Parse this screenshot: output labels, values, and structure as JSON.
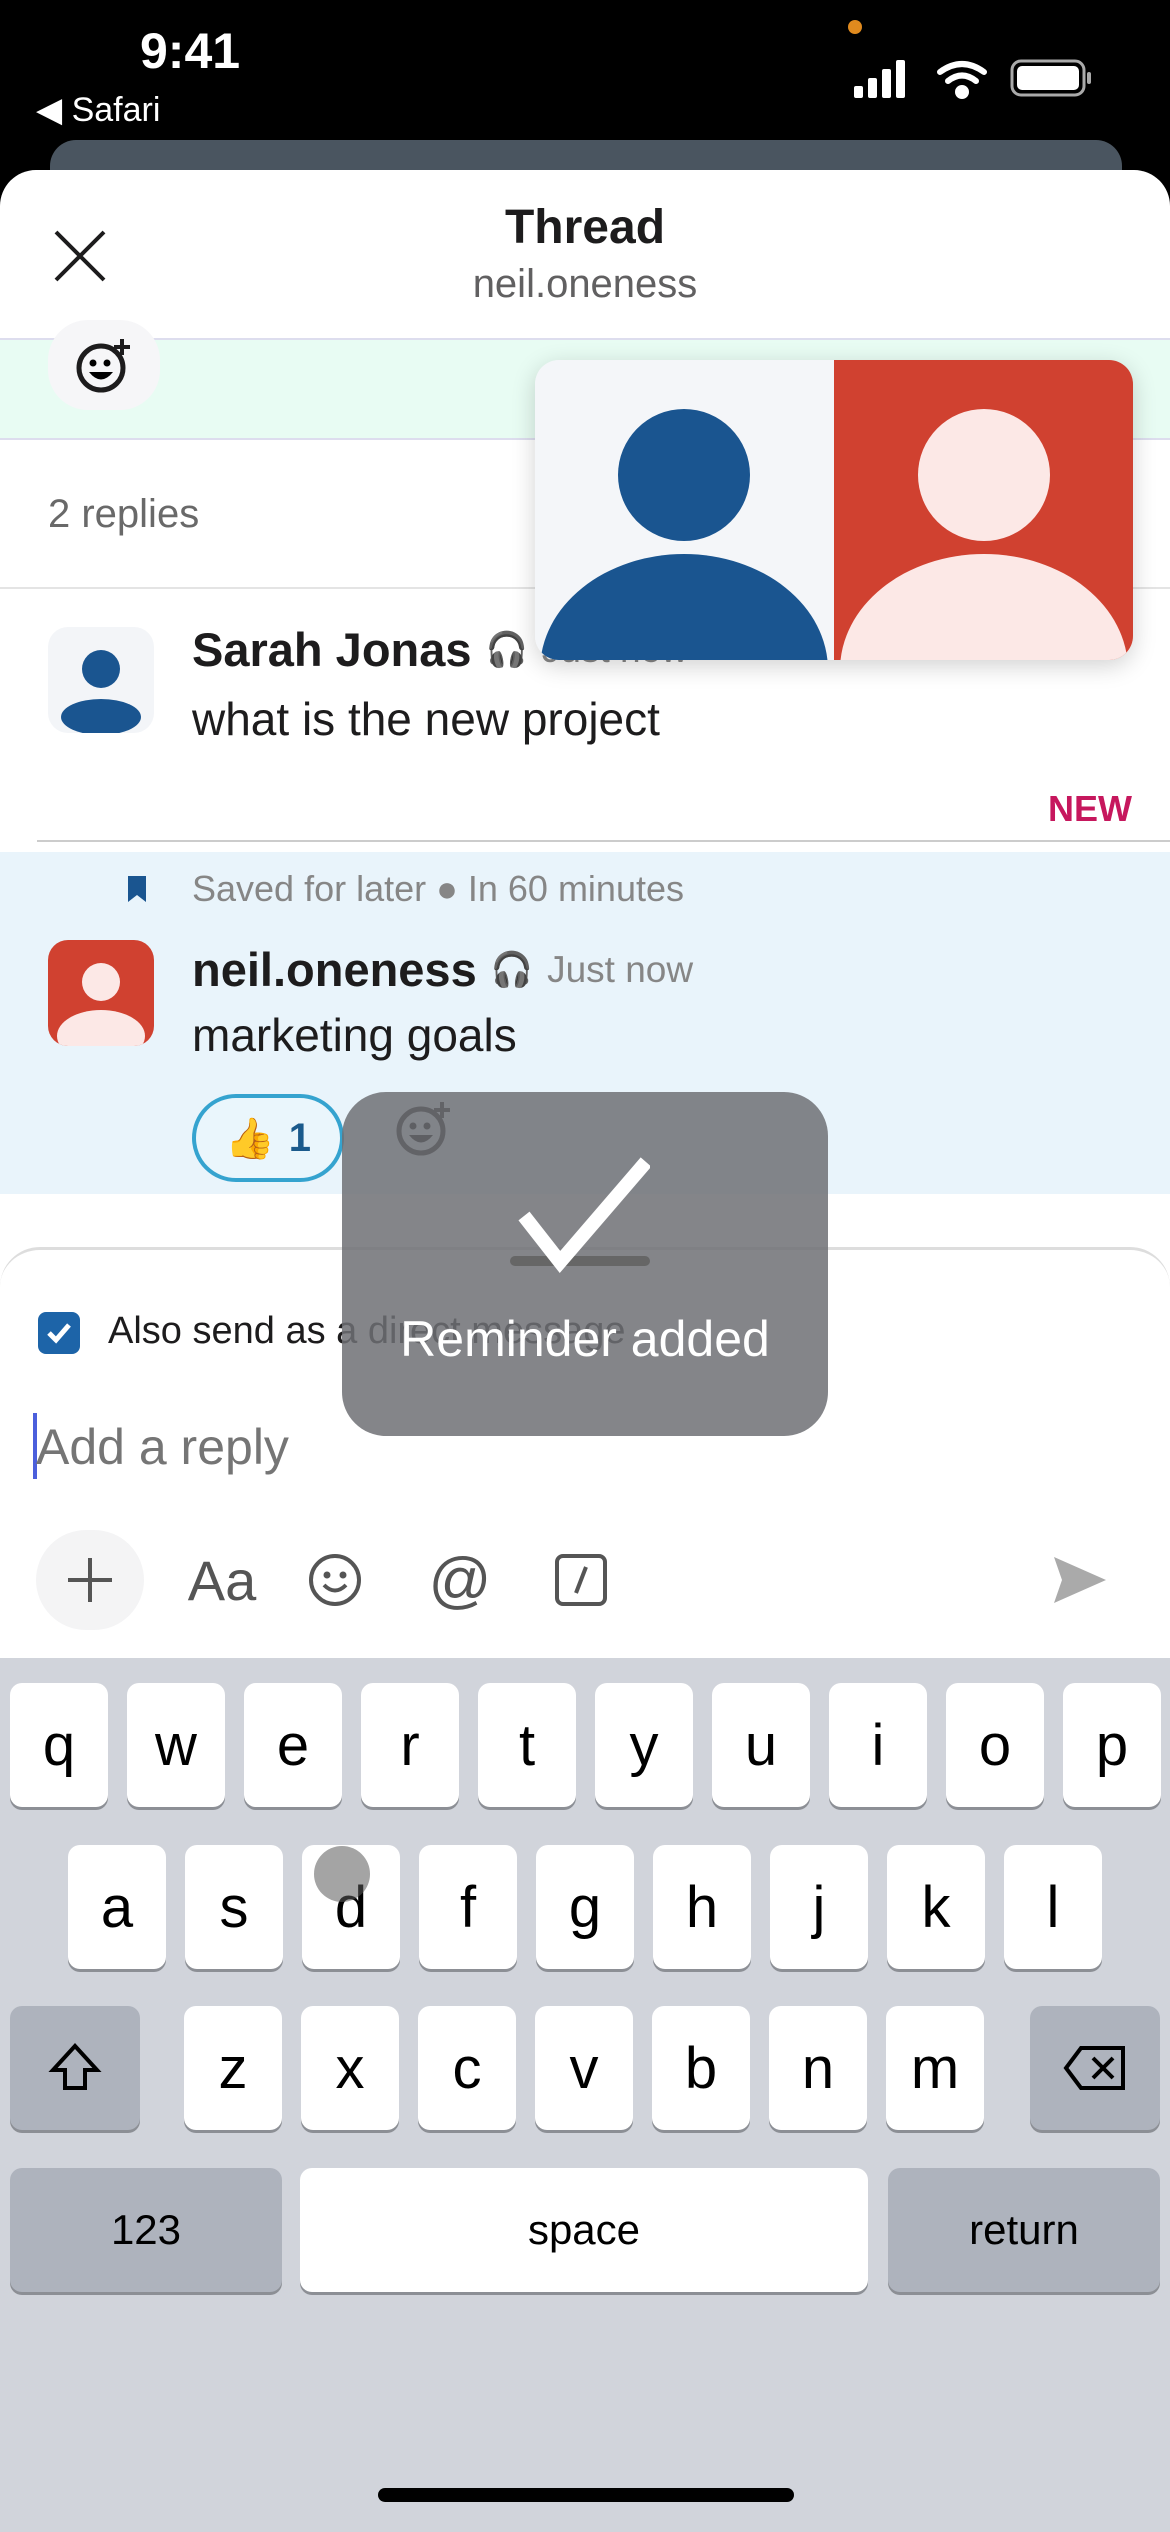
{
  "status": {
    "time": "9:41",
    "back_app": "Safari"
  },
  "header": {
    "title": "Thread",
    "subtitle": "neil.oneness"
  },
  "thread": {
    "replies_count": "2 replies"
  },
  "messages": [
    {
      "author": "Sarah Jonas",
      "time": "Just now",
      "text": "what is the new project",
      "avatar_color": "#1a5590",
      "new_label": "NEW"
    },
    {
      "author": "neil.oneness",
      "time": "Just now",
      "text": "marketing goals",
      "avatar_color": "#d04130",
      "saved": "Saved for later",
      "saved_due": "In 60 minutes",
      "reaction": {
        "emoji": "👍",
        "count": "1"
      }
    }
  ],
  "toast": {
    "text": "Reminder added"
  },
  "composer": {
    "also_send_label": "Also send as a direct message",
    "also_send_checked": true,
    "placeholder": "Add a reply",
    "format_label": "Aa"
  },
  "keyboard": {
    "row1": [
      "q",
      "w",
      "e",
      "r",
      "t",
      "y",
      "u",
      "i",
      "o",
      "p"
    ],
    "row2": [
      "a",
      "s",
      "d",
      "f",
      "g",
      "h",
      "j",
      "k",
      "l"
    ],
    "row3": [
      "z",
      "x",
      "c",
      "v",
      "b",
      "n",
      "m"
    ],
    "numbers": "123",
    "space": "space",
    "return": "return"
  },
  "colors": {
    "accent": "#1d64a8",
    "new": "#c6175d",
    "saved_bg": "#e9f4fb"
  }
}
